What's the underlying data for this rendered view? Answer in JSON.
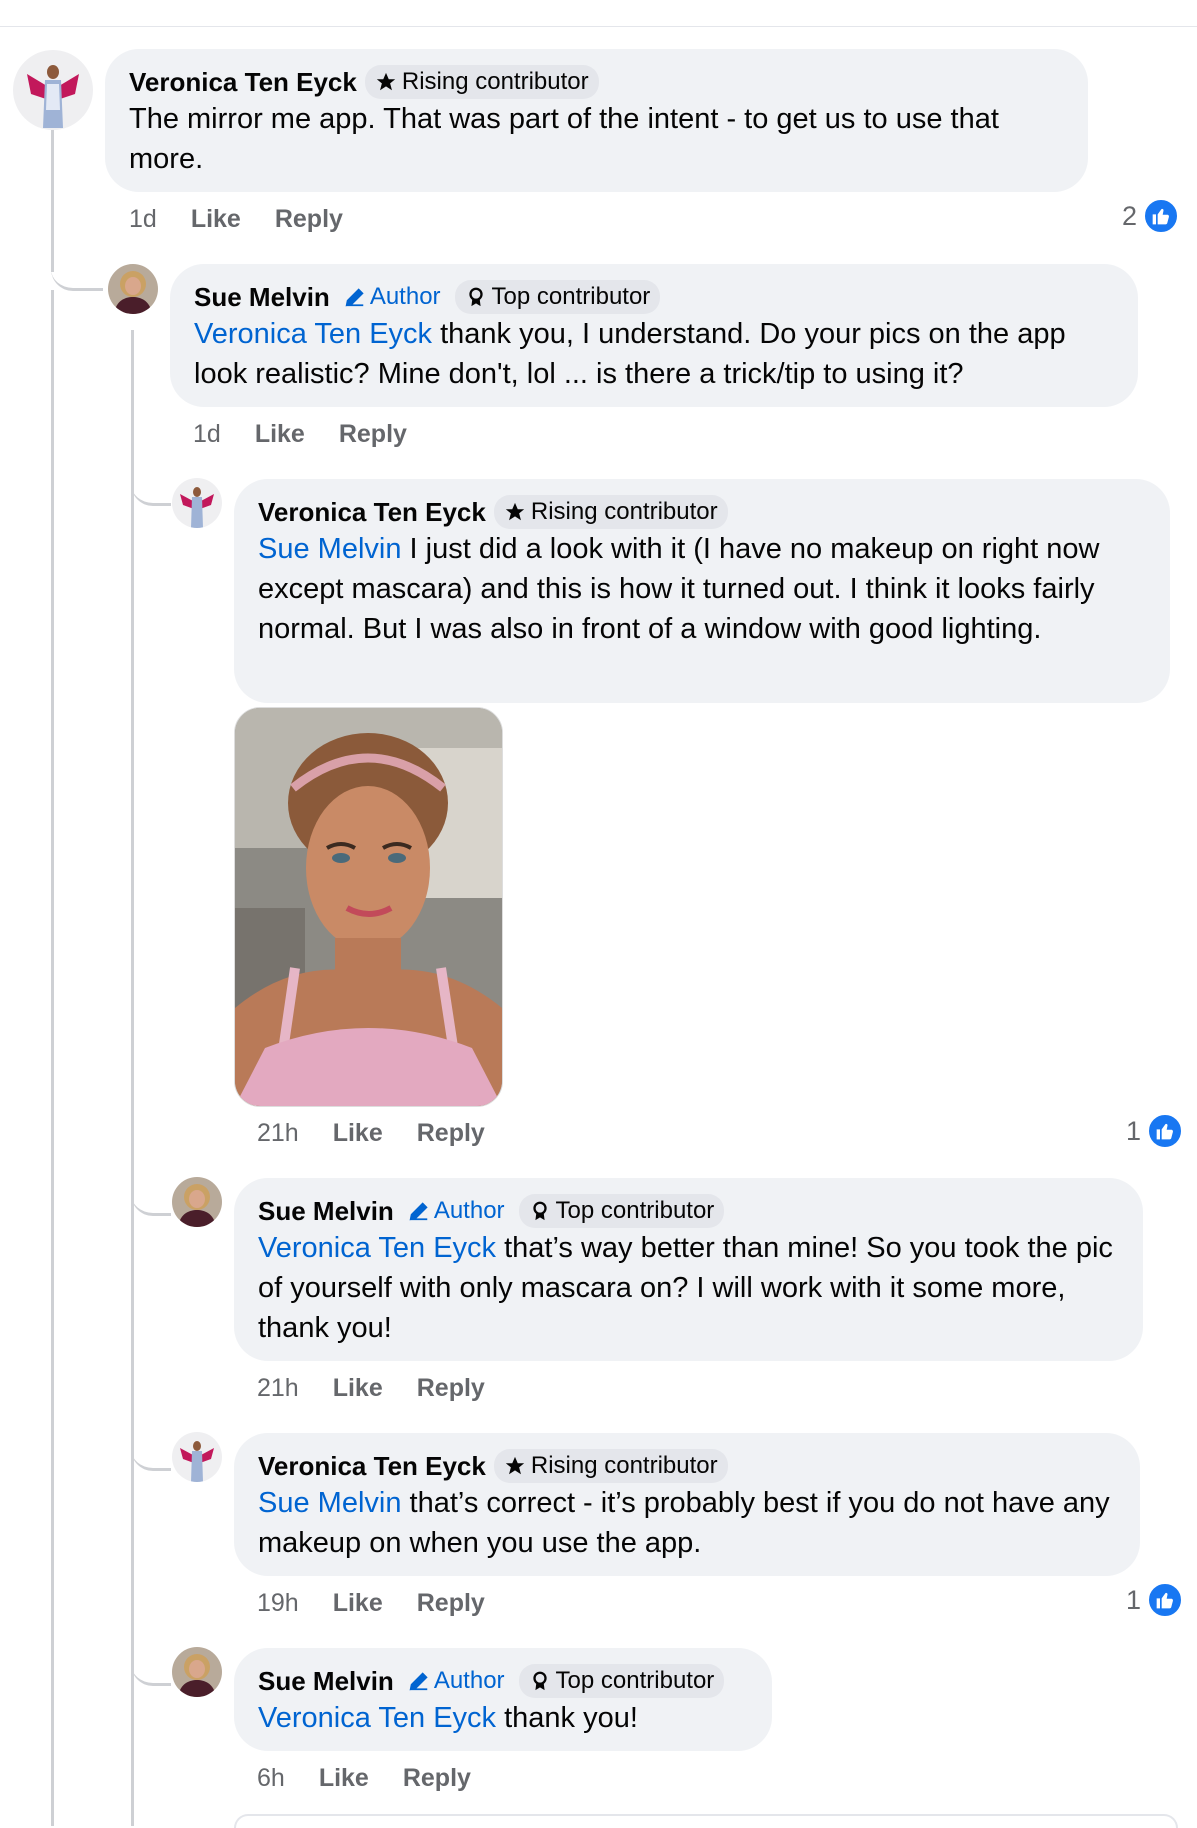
{
  "comments": [
    {
      "author": "Veronica Ten Eyck",
      "badge": "Rising contributor",
      "text": "The mirror me app. That was part of the intent - to get us to use that more.",
      "time": "1d",
      "like_label": "Like",
      "reply_label": "Reply",
      "reactions": "2"
    },
    {
      "author": "Sue Melvin",
      "author_tag": "Author",
      "badge": "Top contributor",
      "mention": "Veronica Ten Eyck",
      "text": " thank you, I understand. Do your pics on the app look realistic? Mine don't, lol ... is there a trick/tip to using it?",
      "time": "1d",
      "like_label": "Like",
      "reply_label": "Reply"
    },
    {
      "author": "Veronica Ten Eyck",
      "badge": "Rising contributor",
      "mention": "Sue Melvin",
      "text": " I just did a look with it (I have no makeup on right now except mascara) and this is how it turned out.  I think it looks fairly normal. But I was also in front of a window with good lighting.",
      "time": "21h",
      "like_label": "Like",
      "reply_label": "Reply",
      "reactions": "1"
    },
    {
      "author": "Sue Melvin",
      "author_tag": "Author",
      "badge": "Top contributor",
      "mention": "Veronica Ten Eyck",
      "text": " that’s way better than mine! So you took the pic of yourself with only mascara on? I will work with it some more, thank you!",
      "time": "21h",
      "like_label": "Like",
      "reply_label": "Reply"
    },
    {
      "author": "Veronica Ten Eyck",
      "badge": "Rising contributor",
      "mention": "Sue Melvin",
      "text": " that’s correct - it’s probably best if you do not have any makeup on when you use the app.",
      "time": "19h",
      "like_label": "Like",
      "reply_label": "Reply",
      "reactions": "1"
    },
    {
      "author": "Sue Melvin",
      "author_tag": "Author",
      "badge": "Top contributor",
      "mention": "Veronica Ten Eyck",
      "text": " thank you!",
      "time": "6h",
      "like_label": "Like",
      "reply_label": "Reply"
    }
  ],
  "colors": {
    "link": "#0064d1",
    "bubble": "#f0f2f5",
    "meta": "#65676b",
    "like": "#1877f2"
  }
}
